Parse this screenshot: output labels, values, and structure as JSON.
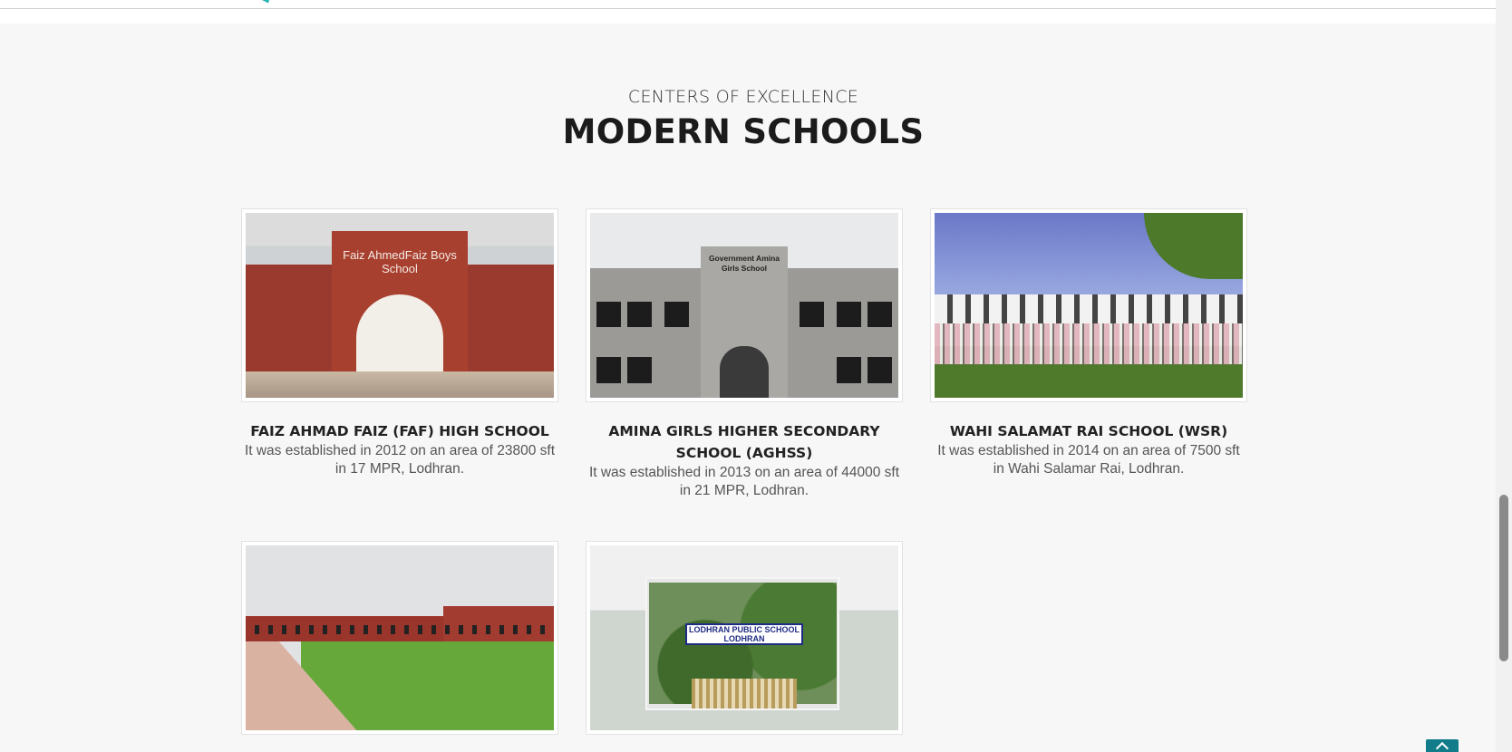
{
  "section": {
    "eyebrow": "CENTERS OF EXCELLENCE",
    "title": "MODERN SCHOOLS"
  },
  "schools": [
    {
      "title": "FAIZ AHMAD FAIZ (FAF) HIGH SCHOOL",
      "description": "It was established in 2012 on an area of 23800 sft in 17 MPR, Lodhran.",
      "photo_sign": "Faiz AhmedFaiz Boys School"
    },
    {
      "title": "AMINA GIRLS HIGHER SECONDARY SCHOOL (AGHSS)",
      "description": "It was established in 2013 on an area of 44000 sft in 21 MPR, Lodhran.",
      "photo_sign": "Government Amina Girls School"
    },
    {
      "title": "WAHI SALAMAT RAI SCHOOL (WSR)",
      "description": "It was established in 2014 on an area of 7500 sft in Wahi Salamar Rai, Lodhran."
    },
    {
      "title": "",
      "description": ""
    },
    {
      "title": "",
      "description": "",
      "photo_sign": "LODHRAN PUBLIC SCHOOL LODHRAN"
    }
  ],
  "colors": {
    "accent": "#127c8a",
    "logo": "#27b3b3",
    "background": "#f7f7f7"
  },
  "icons": {
    "back_to_top": "chevron-up-icon"
  }
}
